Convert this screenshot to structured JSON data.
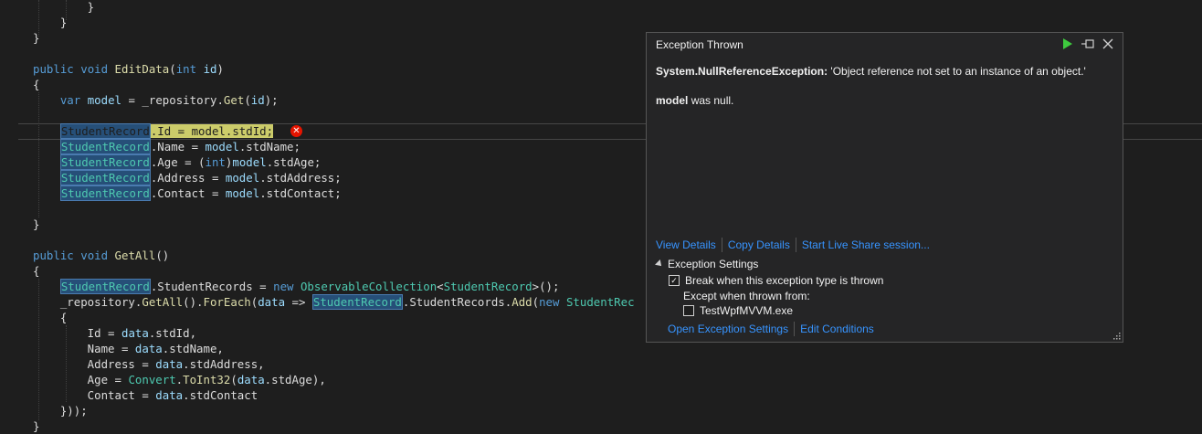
{
  "editor": {
    "lines": [
      {
        "id": "l1",
        "tokens": [
          {
            "t": "        }",
            "c": "pl"
          }
        ]
      },
      {
        "id": "l2",
        "tokens": [
          {
            "t": "    }",
            "c": "pl"
          }
        ]
      },
      {
        "id": "l3",
        "tokens": [
          {
            "t": "}",
            "c": "pl"
          }
        ]
      },
      {
        "id": "l4",
        "tokens": []
      },
      {
        "id": "l5",
        "tokens": [
          {
            "t": "public",
            "c": "kw"
          },
          {
            "t": " ",
            "c": "pl"
          },
          {
            "t": "void",
            "c": "kw"
          },
          {
            "t": " ",
            "c": "pl"
          },
          {
            "t": "EditData",
            "c": "fn"
          },
          {
            "t": "(",
            "c": "pl"
          },
          {
            "t": "int",
            "c": "kw"
          },
          {
            "t": " ",
            "c": "pl"
          },
          {
            "t": "id",
            "c": "pm"
          },
          {
            "t": ")",
            "c": "pl"
          }
        ]
      },
      {
        "id": "l6",
        "tokens": [
          {
            "t": "{",
            "c": "pl"
          }
        ]
      },
      {
        "id": "l7",
        "tokens": [
          {
            "t": "    ",
            "c": "pl"
          },
          {
            "t": "var",
            "c": "kw"
          },
          {
            "t": " ",
            "c": "pl"
          },
          {
            "t": "model",
            "c": "pm"
          },
          {
            "t": " = _repository.",
            "c": "pl"
          },
          {
            "t": "Get",
            "c": "fn"
          },
          {
            "t": "(",
            "c": "pl"
          },
          {
            "t": "id",
            "c": "pm"
          },
          {
            "t": ");",
            "c": "pl"
          }
        ]
      },
      {
        "id": "l8",
        "tokens": []
      },
      {
        "id": "l9",
        "tokens": [
          {
            "t": "    ",
            "c": "pl"
          },
          {
            "t": "StudentRecord",
            "c": "hlcur"
          },
          {
            "t": ".Id = model.stdId;",
            "c": "stmt"
          }
        ]
      },
      {
        "id": "l10",
        "tokens": [
          {
            "t": "    ",
            "c": "pl"
          },
          {
            "t": "StudentRecord",
            "c": "ref"
          },
          {
            "t": ".Name = ",
            "c": "pl"
          },
          {
            "t": "model",
            "c": "pm"
          },
          {
            "t": ".stdName;",
            "c": "pl"
          }
        ]
      },
      {
        "id": "l11",
        "tokens": [
          {
            "t": "    ",
            "c": "pl"
          },
          {
            "t": "StudentRecord",
            "c": "ref"
          },
          {
            "t": ".Age = (",
            "c": "pl"
          },
          {
            "t": "int",
            "c": "kw"
          },
          {
            "t": ")",
            "c": "pl"
          },
          {
            "t": "model",
            "c": "pm"
          },
          {
            "t": ".stdAge;",
            "c": "pl"
          }
        ]
      },
      {
        "id": "l12",
        "tokens": [
          {
            "t": "    ",
            "c": "pl"
          },
          {
            "t": "StudentRecord",
            "c": "ref"
          },
          {
            "t": ".Address = ",
            "c": "pl"
          },
          {
            "t": "model",
            "c": "pm"
          },
          {
            "t": ".stdAddress;",
            "c": "pl"
          }
        ]
      },
      {
        "id": "l13",
        "tokens": [
          {
            "t": "    ",
            "c": "pl"
          },
          {
            "t": "StudentRecord",
            "c": "ref"
          },
          {
            "t": ".Contact = ",
            "c": "pl"
          },
          {
            "t": "model",
            "c": "pm"
          },
          {
            "t": ".stdContact;",
            "c": "pl"
          }
        ]
      },
      {
        "id": "l14",
        "tokens": []
      },
      {
        "id": "l15",
        "tokens": [
          {
            "t": "}",
            "c": "pl"
          }
        ]
      },
      {
        "id": "l16",
        "tokens": []
      },
      {
        "id": "l17",
        "tokens": [
          {
            "t": "public",
            "c": "kw"
          },
          {
            "t": " ",
            "c": "pl"
          },
          {
            "t": "void",
            "c": "kw"
          },
          {
            "t": " ",
            "c": "pl"
          },
          {
            "t": "GetAll",
            "c": "fn"
          },
          {
            "t": "()",
            "c": "pl"
          }
        ]
      },
      {
        "id": "l18",
        "tokens": [
          {
            "t": "{",
            "c": "pl"
          }
        ]
      },
      {
        "id": "l19",
        "tokens": [
          {
            "t": "    ",
            "c": "pl"
          },
          {
            "t": "StudentRecord",
            "c": "ref"
          },
          {
            "t": ".StudentRecords = ",
            "c": "pl"
          },
          {
            "t": "new",
            "c": "kw"
          },
          {
            "t": " ",
            "c": "pl"
          },
          {
            "t": "ObservableCollection",
            "c": "ty"
          },
          {
            "t": "<",
            "c": "pl"
          },
          {
            "t": "StudentRecord",
            "c": "ty"
          },
          {
            "t": ">();",
            "c": "pl"
          }
        ]
      },
      {
        "id": "l20",
        "tokens": [
          {
            "t": "    _repository.",
            "c": "pl"
          },
          {
            "t": "GetAll",
            "c": "fn"
          },
          {
            "t": "().",
            "c": "pl"
          },
          {
            "t": "ForEach",
            "c": "fn"
          },
          {
            "t": "(",
            "c": "pl"
          },
          {
            "t": "data",
            "c": "pm"
          },
          {
            "t": " => ",
            "c": "pl"
          },
          {
            "t": "StudentRecord",
            "c": "ref"
          },
          {
            "t": ".StudentRecords.",
            "c": "pl"
          },
          {
            "t": "Add",
            "c": "fn"
          },
          {
            "t": "(",
            "c": "pl"
          },
          {
            "t": "new",
            "c": "kw"
          },
          {
            "t": " ",
            "c": "pl"
          },
          {
            "t": "StudentRec",
            "c": "ty"
          }
        ]
      },
      {
        "id": "l21",
        "tokens": [
          {
            "t": "    {",
            "c": "pl"
          }
        ]
      },
      {
        "id": "l22",
        "tokens": [
          {
            "t": "        Id = ",
            "c": "pl"
          },
          {
            "t": "data",
            "c": "pm"
          },
          {
            "t": ".stdId,",
            "c": "pl"
          }
        ]
      },
      {
        "id": "l23",
        "tokens": [
          {
            "t": "        Name = ",
            "c": "pl"
          },
          {
            "t": "data",
            "c": "pm"
          },
          {
            "t": ".stdName,",
            "c": "pl"
          }
        ]
      },
      {
        "id": "l24",
        "tokens": [
          {
            "t": "        Address = ",
            "c": "pl"
          },
          {
            "t": "data",
            "c": "pm"
          },
          {
            "t": ".stdAddress,",
            "c": "pl"
          }
        ]
      },
      {
        "id": "l25",
        "tokens": [
          {
            "t": "        Age = ",
            "c": "pl"
          },
          {
            "t": "Convert",
            "c": "ty"
          },
          {
            "t": ".",
            "c": "pl"
          },
          {
            "t": "ToInt32",
            "c": "fn"
          },
          {
            "t": "(",
            "c": "pl"
          },
          {
            "t": "data",
            "c": "pm"
          },
          {
            "t": ".stdAge),",
            "c": "pl"
          }
        ]
      },
      {
        "id": "l26",
        "tokens": [
          {
            "t": "        Contact = ",
            "c": "pl"
          },
          {
            "t": "data",
            "c": "pm"
          },
          {
            "t": ".stdContact",
            "c": "pl"
          }
        ]
      },
      {
        "id": "l27",
        "tokens": [
          {
            "t": "    }));",
            "c": "pl"
          }
        ]
      },
      {
        "id": "l28",
        "tokens": [
          {
            "t": "}",
            "c": "pl"
          }
        ]
      }
    ]
  },
  "popup": {
    "title": "Exception Thrown",
    "exception_type": "System.NullReferenceException:",
    "exception_message": "'Object reference not set to an instance of an object.'",
    "null_var": "model",
    "null_suffix": "was null.",
    "link_view_details": "View Details",
    "link_copy_details": "Copy Details",
    "link_live_share": "Start Live Share session...",
    "settings_header": "Exception Settings",
    "break_label": "Break when this exception type is thrown",
    "break_checked": true,
    "except_label": "Except when thrown from:",
    "module_label": "TestWpfMVVM.exe",
    "module_checked": false,
    "link_open_settings": "Open Exception Settings",
    "link_edit_conditions": "Edit Conditions",
    "colors": {
      "link": "#3794ff",
      "continue": "#3ec93e",
      "error": "#e51400"
    }
  }
}
